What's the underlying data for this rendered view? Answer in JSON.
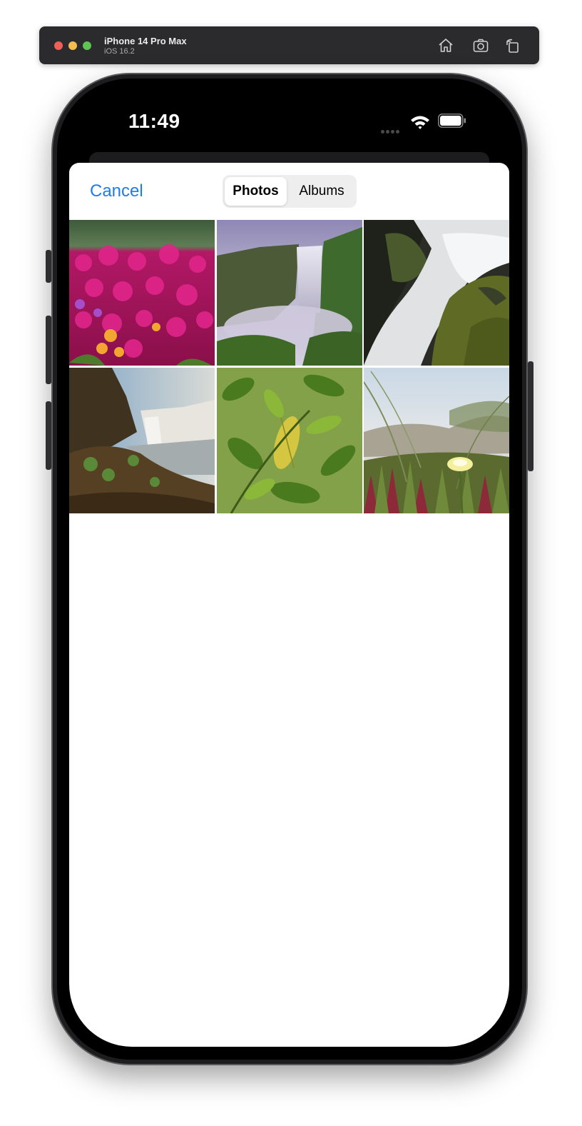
{
  "simulator": {
    "device_name": "iPhone 14 Pro Max",
    "os_version": "iOS 16.2",
    "toolbar_icons": [
      "home-icon",
      "screenshot-icon",
      "rotate-icon"
    ]
  },
  "status_bar": {
    "time": "11:49",
    "icons": [
      "signal-dots-icon",
      "wifi-icon",
      "battery-icon"
    ]
  },
  "picker": {
    "cancel_label": "Cancel",
    "accent_color": "#1a7df0",
    "segments": [
      {
        "label": "Photos",
        "selected": true
      },
      {
        "label": "Albums",
        "selected": false
      }
    ]
  },
  "photos": [
    {
      "subject": "pink-flowers"
    },
    {
      "subject": "waterfall-valley"
    },
    {
      "subject": "rocky-waterfall"
    },
    {
      "subject": "waterfall-cliff"
    },
    {
      "subject": "green-leaves"
    },
    {
      "subject": "white-flower-dunes"
    }
  ]
}
